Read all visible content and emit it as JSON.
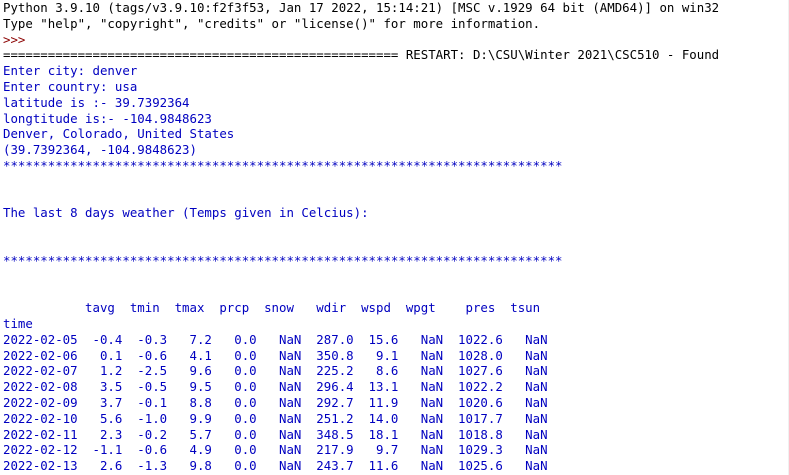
{
  "shell": {
    "banner": [
      "Python 3.9.10 (tags/v3.9.10:f2f3f53, Jan 17 2022, 15:14:21) [MSC v.1929 64 bit (AMD64)] on win32",
      "Type \"help\", \"copyright\", \"credits\" or \"license()\" for more information."
    ],
    "prompt": ">>> ",
    "restart_line": "===================================================== RESTART: D:\\CSU\\Winter 2021\\CSC510 - Found",
    "session": [
      "Enter city: denver",
      "Enter country: usa",
      "latitude is :- 39.7392364",
      "longtitude is:- -104.9848623",
      "Denver, Colorado, United States",
      "(39.7392364, -104.9848623)",
      "***************************************************************************"
    ],
    "weather_title": "The last 8 days weather (Temps given in Celcius):",
    "separator": "***************************************************************************",
    "table": {
      "header": "           tavg  tmin  tmax  prcp  snow   wdir  wspd  wpgt    pres  tsun",
      "index_label": "time",
      "rows": [
        "2022-02-05  -0.4  -0.3   7.2   0.0   NaN  287.0  15.6   NaN  1022.6   NaN",
        "2022-02-06   0.1  -0.6   4.1   0.0   NaN  350.8   9.1   NaN  1028.0   NaN",
        "2022-02-07   1.2  -2.5   9.6   0.0   NaN  225.2   8.6   NaN  1027.6   NaN",
        "2022-02-08   3.5  -0.5   9.5   0.0   NaN  296.4  13.1   NaN  1022.2   NaN",
        "2022-02-09   3.7  -0.1   8.8   0.0   NaN  292.7  11.9   NaN  1020.6   NaN",
        "2022-02-10   5.6  -1.0   9.9   0.0   NaN  251.2  14.0   NaN  1017.7   NaN",
        "2022-02-11   2.3  -0.2   5.7   0.0   NaN  348.5  18.1   NaN  1018.8   NaN",
        "2022-02-12  -1.1  -0.6   4.9   0.0   NaN  217.9   9.7   NaN  1029.3   NaN",
        "2022-02-13   2.6  -1.3   9.8   0.0   NaN  243.7  11.6   NaN  1025.6   NaN"
      ]
    }
  },
  "colors": {
    "stdout": "#0000c0",
    "prompt": "#8b0000",
    "text": "#000000"
  }
}
